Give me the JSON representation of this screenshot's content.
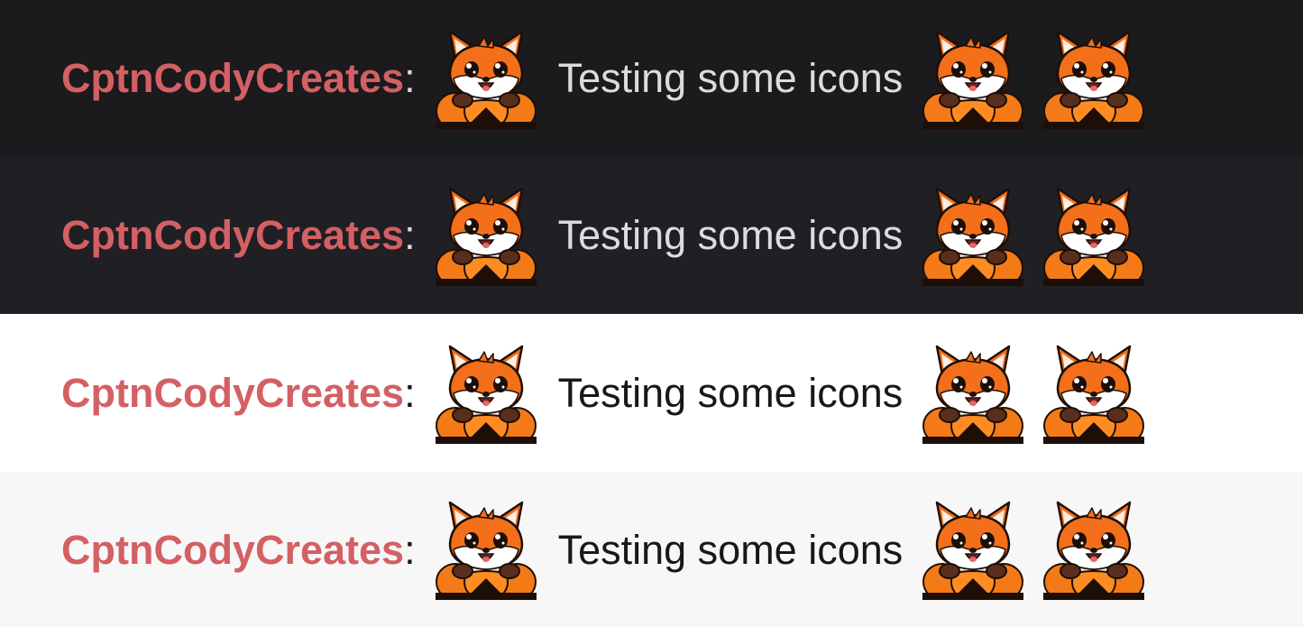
{
  "emote": {
    "name": "fox-in-pumpkin-emote"
  },
  "colors": {
    "username": "#d36064",
    "fox_orange": "#f36f1a",
    "pumpkin": "#f47a18"
  },
  "rows": [
    {
      "theme": "dark",
      "background": "#1b1a1c",
      "text_color": "#dcdcdf",
      "username": "CptnCodyCreates",
      "separator": ":",
      "message": "Testing some icons"
    },
    {
      "theme": "dark-alt",
      "background": "#201f24",
      "text_color": "#dcdcdf",
      "username": "CptnCodyCreates",
      "separator": ":",
      "message": "Testing some icons"
    },
    {
      "theme": "light",
      "background": "#ffffff",
      "text_color": "#18171a",
      "username": "CptnCodyCreates",
      "separator": ":",
      "message": "Testing some icons"
    },
    {
      "theme": "light-alt",
      "background": "#f7f7f8",
      "text_color": "#18171a",
      "username": "CptnCodyCreates",
      "separator": ":",
      "message": "Testing some icons"
    }
  ]
}
